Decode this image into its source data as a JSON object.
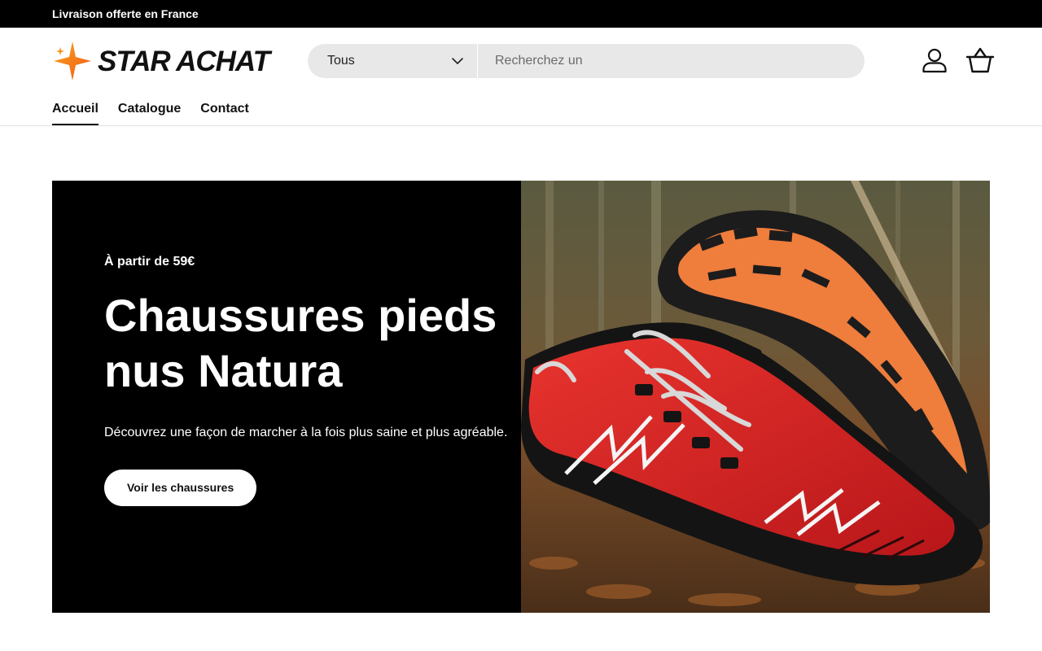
{
  "announcement": {
    "text": "Livraison offerte en France"
  },
  "brand": {
    "name": "STAR ACHAT",
    "accent_color": "#f26522"
  },
  "search": {
    "category_selected": "Tous",
    "placeholder": "Recherchez un",
    "value": ""
  },
  "header_icons": [
    "account-icon",
    "cart-icon"
  ],
  "nav": {
    "items": [
      {
        "label": "Accueil",
        "active": true
      },
      {
        "label": "Catalogue",
        "active": false
      },
      {
        "label": "Contact",
        "active": false
      }
    ]
  },
  "hero": {
    "kicker": "À partir de 59€",
    "title": "Chaussures pieds nus Natura",
    "description": "Découvrez une façon de marcher à la fois plus saine et plus agréable.",
    "button_label": "Voir les chaussures",
    "image_subject": "red barefoot running shoes on forest floor"
  }
}
